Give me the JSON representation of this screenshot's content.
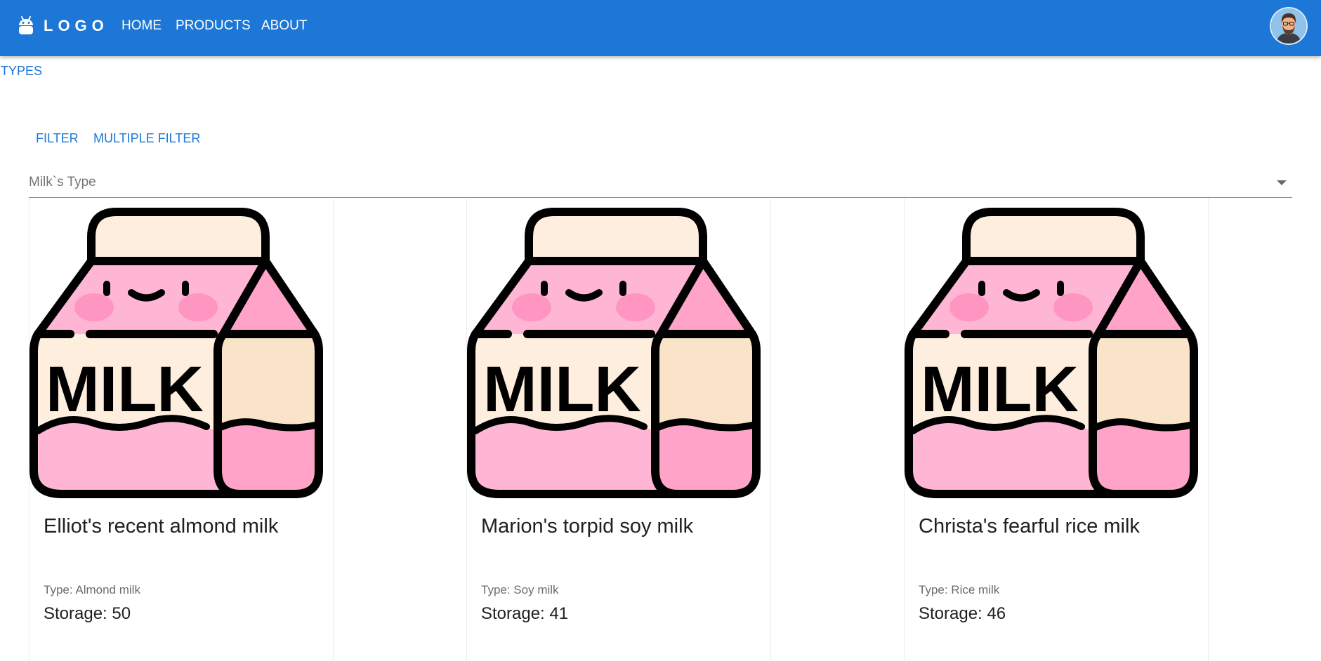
{
  "header": {
    "logo_text": "LOGO",
    "logo_icon": "android-icon",
    "nav": [
      {
        "label": "HOME"
      },
      {
        "label": "PRODUCTS"
      },
      {
        "label": "ABOUT"
      }
    ],
    "avatar_icon": "user-avatar"
  },
  "types_link": "TYPES",
  "tabs": [
    {
      "label": "FILTER"
    },
    {
      "label": "MULTIPLE FILTER"
    }
  ],
  "select": {
    "label": "Milk`s Type",
    "icon": "caret-down-icon"
  },
  "image_text": "MILK",
  "products": [
    {
      "title": "Elliot's recent almond milk",
      "type": "Type: Almond milk",
      "storage": "Storage: 50"
    },
    {
      "title": "Marion's torpid soy milk",
      "type": "Type: Soy milk",
      "storage": "Storage: 41"
    },
    {
      "title": "Christa's fearful rice milk",
      "type": "Type: Rice milk",
      "storage": "Storage: 46"
    }
  ],
  "colors": {
    "appbar": "#1c77d6",
    "primary_text": "#1c77d6",
    "carton_pink": "#ffb6d5",
    "carton_pink_dark": "#ffa3c8",
    "carton_cream": "#fdeedd",
    "carton_cream_dark": "#f9e3c9"
  }
}
